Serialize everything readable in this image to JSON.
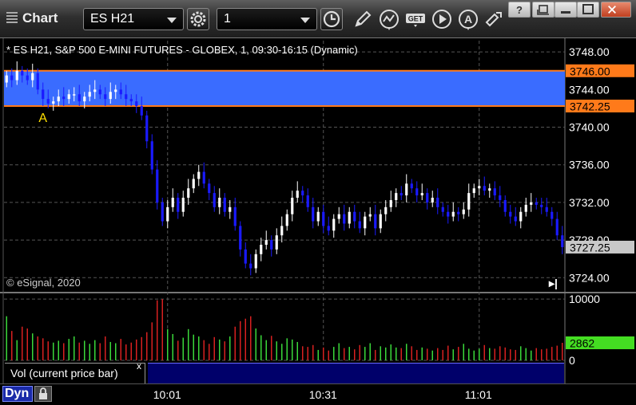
{
  "window": {
    "title": "Chart",
    "symbol": "ES H21",
    "interval": "1"
  },
  "chart_header": "* ES H21, S&P 500 E-MINI FUTURES - GLOBEX, 1, 09:30-16:15 (Dynamic)",
  "copyright": "© eSignal, 2020",
  "volume_study_label": "Vol (current price bar)",
  "volume_close_symbol": "x",
  "mode_label": "Dyn",
  "marker_label": "A",
  "colors": {
    "up": "#ffffff",
    "down": "#1a1aff",
    "zone": "#3a6cff",
    "zone_line": "#ff7a1a",
    "price_tag": "#ff7a1a",
    "last_tag": "#c8c8c8",
    "vol_up": "#3ad83a",
    "vol_down": "#d82020",
    "vol_tag": "#44dd22"
  },
  "chart_data": [
    {
      "type": "candlestick",
      "title": "* ES H21, S&P 500 E-MINI FUTURES - GLOBEX, 1, 09:30-16:15 (Dynamic)",
      "ylim": [
        3722.5,
        3749.2
      ],
      "y_ticks": [
        "3748.00",
        "3744.00",
        "3740.00",
        "3736.00",
        "3732.00",
        "3728.00",
        "3724.00"
      ],
      "y_tick_values": [
        3748,
        3744,
        3740,
        3736,
        3732,
        3728,
        3724
      ],
      "x_ticks": [
        "10:01",
        "10:31",
        "11:01"
      ],
      "x_tick_bars": [
        31,
        61,
        91
      ],
      "grid": true,
      "zone": {
        "high": 3746.0,
        "low": 3742.25,
        "high_label": "3746.00",
        "low_label": "3742.25"
      },
      "last_price": {
        "value": 3727.25,
        "label": "3727.25"
      },
      "marker": {
        "bar": 7,
        "label": "A"
      },
      "closes": [
        3745.5,
        3745.0,
        3746.0,
        3745.5,
        3745.0,
        3745.75,
        3744.0,
        3743.0,
        3742.5,
        3742.75,
        3743.25,
        3743.0,
        3743.5,
        3743.5,
        3742.75,
        3743.25,
        3743.75,
        3744.0,
        3743.5,
        3743.0,
        3743.75,
        3744.0,
        3743.5,
        3743.0,
        3742.75,
        3742.25,
        3741.25,
        3738.5,
        3735.5,
        3732.0,
        3730.0,
        3731.5,
        3732.5,
        3731.0,
        3732.5,
        3733.5,
        3734.5,
        3735.25,
        3734.0,
        3733.0,
        3731.5,
        3732.5,
        3731.0,
        3731.5,
        3729.5,
        3727.0,
        3725.5,
        3725.0,
        3726.5,
        3727.5,
        3728.0,
        3727.0,
        3728.5,
        3729.5,
        3730.75,
        3732.5,
        3733.25,
        3732.75,
        3731.5,
        3730.0,
        3731.0,
        3729.5,
        3729.0,
        3730.25,
        3730.75,
        3729.75,
        3731.0,
        3730.0,
        3729.25,
        3730.5,
        3730.75,
        3729.25,
        3730.75,
        3731.5,
        3732.25,
        3733.0,
        3732.75,
        3734.0,
        3733.5,
        3732.75,
        3733.0,
        3732.0,
        3732.5,
        3731.5,
        3731.0,
        3730.5,
        3731.0,
        3730.75,
        3731.25,
        3733.0,
        3733.5,
        3733.75,
        3733.25,
        3733.5,
        3732.75,
        3732.25,
        3731.0,
        3730.5,
        3730.0,
        3731.0,
        3731.75,
        3732.0,
        3731.75,
        3731.5,
        3731.0,
        3730.25,
        3728.5,
        3727.25
      ],
      "x_count": 108,
      "series": [
        {
          "values": "closes"
        }
      ]
    },
    {
      "type": "bar",
      "ylim": [
        0,
        10800
      ],
      "y_ticks": [
        "10000",
        "0"
      ],
      "y_tick_values": [
        10000,
        0
      ],
      "last_volume": {
        "value": 2862,
        "label": "2862"
      },
      "values": [
        7200,
        4800,
        3300,
        5500,
        5200,
        4400,
        3900,
        3600,
        3100,
        2900,
        3200,
        2800,
        3500,
        3900,
        2900,
        3200,
        2700,
        3300,
        2800,
        3900,
        3000,
        2800,
        3500,
        2600,
        2900,
        3400,
        3800,
        4600,
        6200,
        9800,
        10000,
        5100,
        4300,
        3200,
        3700,
        5100,
        4200,
        3900,
        3300,
        2700,
        3800,
        3400,
        3100,
        3900,
        5500,
        6400,
        6800,
        7200,
        5200,
        4100,
        3300,
        4000,
        3100,
        2700,
        3600,
        3400,
        3000,
        2300,
        2200,
        2500,
        1700,
        2100,
        1600,
        2200,
        2800,
        2000,
        2200,
        1800,
        2500,
        2200,
        2800,
        1700,
        2300,
        2100,
        2600,
        2100,
        2000,
        2700,
        2300,
        1700,
        2100,
        1900,
        1600,
        2000,
        1700,
        2400,
        1800,
        2200,
        2700,
        1900,
        1600,
        1900,
        2500,
        2000,
        1900,
        2300,
        2100,
        1800,
        1700,
        2300,
        2000,
        1600,
        2000,
        1800,
        1900,
        2200,
        2400,
        2862
      ]
    }
  ]
}
